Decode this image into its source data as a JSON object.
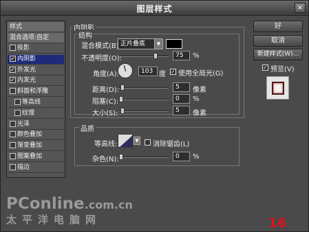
{
  "window": {
    "title": "图层样式",
    "close": "×"
  },
  "left_list": [
    {
      "label": "样式",
      "checked": null,
      "header": true
    },
    {
      "label": "混合选项:自定",
      "checked": null,
      "header": true
    },
    {
      "label": "投影",
      "checked": false
    },
    {
      "label": "内阴影",
      "checked": true,
      "selected": true
    },
    {
      "label": "外发光",
      "checked": true
    },
    {
      "label": "内发光",
      "checked": true
    },
    {
      "label": "斜面和浮雕",
      "checked": false
    },
    {
      "label": "等高线",
      "checked": false,
      "indent": true
    },
    {
      "label": "纹理",
      "checked": false,
      "indent": true
    },
    {
      "label": "光泽",
      "checked": false
    },
    {
      "label": "颜色叠加",
      "checked": false
    },
    {
      "label": "渐变叠加",
      "checked": false
    },
    {
      "label": "图案叠加",
      "checked": false
    },
    {
      "label": "描边",
      "checked": false
    }
  ],
  "inner_shadow": {
    "section_title": "内阴影",
    "structure_title": "结构",
    "blend_mode_label": "混合模式(B):",
    "blend_mode_value": "正片叠底",
    "opacity_label": "不透明度(O):",
    "opacity_value": "75",
    "opacity_unit": "%",
    "opacity_fraction": 0.75,
    "angle_label": "角度(A):",
    "angle_value": "103",
    "angle_unit": "度",
    "global_light_label": "使用全局光(G)",
    "global_light_checked": true,
    "distance_label": "距离(D):",
    "distance_value": "5",
    "distance_unit": "像素",
    "choke_label": "阻塞(C):",
    "choke_value": "0",
    "choke_unit": "%",
    "size_label": "大小(S):",
    "size_value": "5",
    "size_unit": "像素",
    "quality_title": "品质",
    "contour_label": "等高线:",
    "anti_alias_label": "消除锯齿(L)",
    "anti_alias_checked": false,
    "noise_label": "杂色(N):",
    "noise_value": "0",
    "noise_unit": "%",
    "shadow_color": "#000000"
  },
  "buttons": {
    "ok": "好",
    "cancel": "取消",
    "new_style": "新建样式(W)...",
    "preview_label": "预览(V)",
    "preview_checked": true
  },
  "watermark": {
    "brand": "PConline",
    "domain": ".com.cn",
    "chinese": "太平洋电脑网"
  },
  "page_number": "16"
}
